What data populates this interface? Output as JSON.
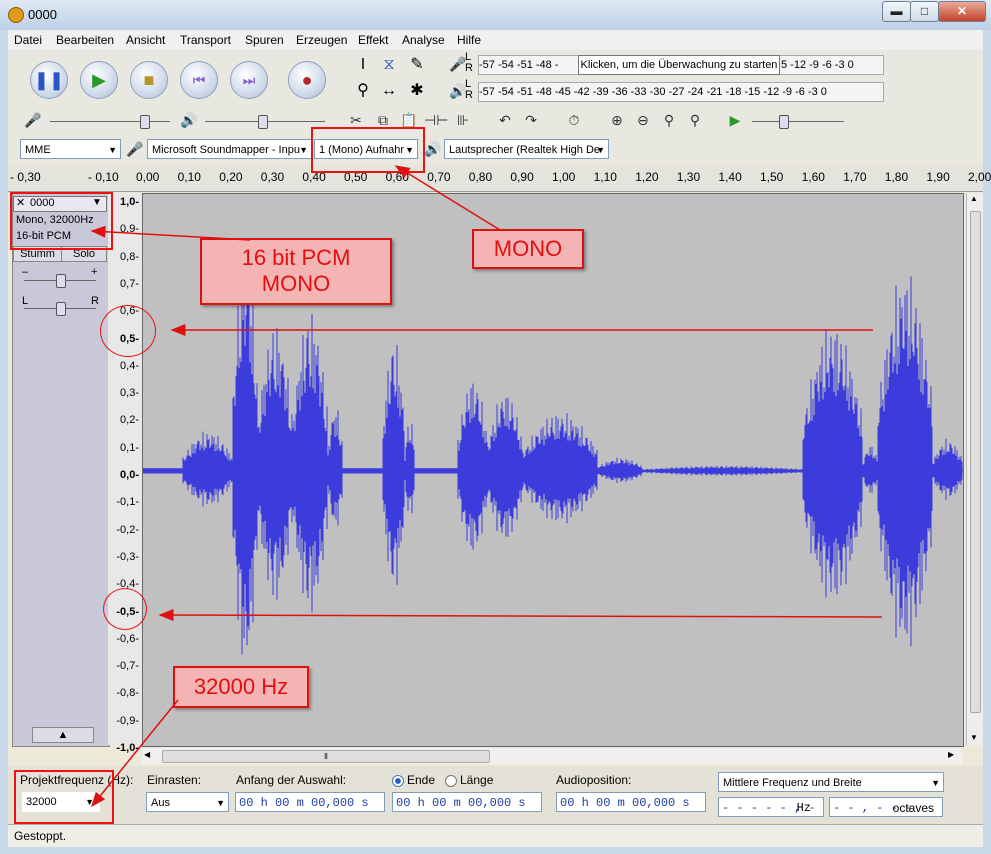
{
  "window": {
    "title": "0000",
    "min_glyph": "▬",
    "max_glyph": "□",
    "close_glyph": "✕"
  },
  "menu": [
    "Datei",
    "Bearbeiten",
    "Ansicht",
    "Transport",
    "Spuren",
    "Erzeugen",
    "Effekt",
    "Analyse",
    "Hilfe"
  ],
  "meters": {
    "record_scale": "-57 -54 -51 -48 -",
    "record_scale_tail": "5 -12  -9  -6  -3  0",
    "play_scale": "-57 -54 -51 -48 -45 -42 -39 -36 -33 -30 -27 -24 -21 -18 -15 -12  -9  -6  -3  0",
    "hint": "Klicken, um die Überwachung zu starten",
    "lr": "L R"
  },
  "devices": {
    "host": "MME",
    "input": "Microsoft Soundmapper - Inpu",
    "channels": "1 (Mono) Aufnahr",
    "output": "Lautsprecher (Realtek High De"
  },
  "ruler_labels": [
    "- 0,30",
    "- 0,10",
    "0,00",
    "0,10",
    "0,20",
    "0,30",
    "0,40",
    "0,50",
    "0,60",
    "0,70",
    "0,80",
    "0,90",
    "1,00",
    "1,10",
    "1,20",
    "1,30",
    "1,40",
    "1,50",
    "1,60",
    "1,70",
    "1,80",
    "1,90",
    "2,00"
  ],
  "track": {
    "name": "0000",
    "format": "Mono, 32000Hz",
    "bits": "16-bit PCM",
    "mute": "Stumm",
    "solo": "Solo",
    "close_glyph": "✕",
    "menu_glyph": "▼",
    "gain_minus": "–",
    "gain_plus": "+",
    "pan_left": "L",
    "pan_right": "R",
    "collapse_glyph": "▲"
  },
  "vertical_scale": [
    "1,0",
    "0,9",
    "0,8",
    "0,7",
    "0,6",
    "0,5",
    "0,4",
    "0,3",
    "0,2",
    "0,1",
    "0,0",
    "-0,1",
    "-0,2",
    "-0,3",
    "-0,4",
    "-0,5",
    "-0,6",
    "-0,7",
    "-0,8",
    "-0,9",
    "-1,0"
  ],
  "bottom": {
    "rate_label": "Projektfrequenz (Hz):",
    "rate_value": "32000",
    "snap_label": "Einrasten:",
    "snap_value": "Aus",
    "sel_start_label": "Anfang der Auswahl:",
    "end_label": "Ende",
    "length_label": "Länge",
    "audio_pos_label": "Audioposition:",
    "time_value": "00 h 00 m 00,000 s",
    "spectral_mode": "Mittlere Frequenz und Breite",
    "freq_value": "- - - - - , - -",
    "freq_unit": "Hz",
    "width_value": "- - , - - -",
    "width_unit": "octaves"
  },
  "status": "Gestoppt.",
  "annotations": {
    "mono": "MONO",
    "pcm_line1": "16 bit PCM",
    "pcm_line2": "MONO",
    "hz": "32000 Hz"
  },
  "colors": {
    "waveform": "#3c3cdc",
    "annotation_red": "#e01010",
    "wave_bg": "#c0c0c0"
  }
}
